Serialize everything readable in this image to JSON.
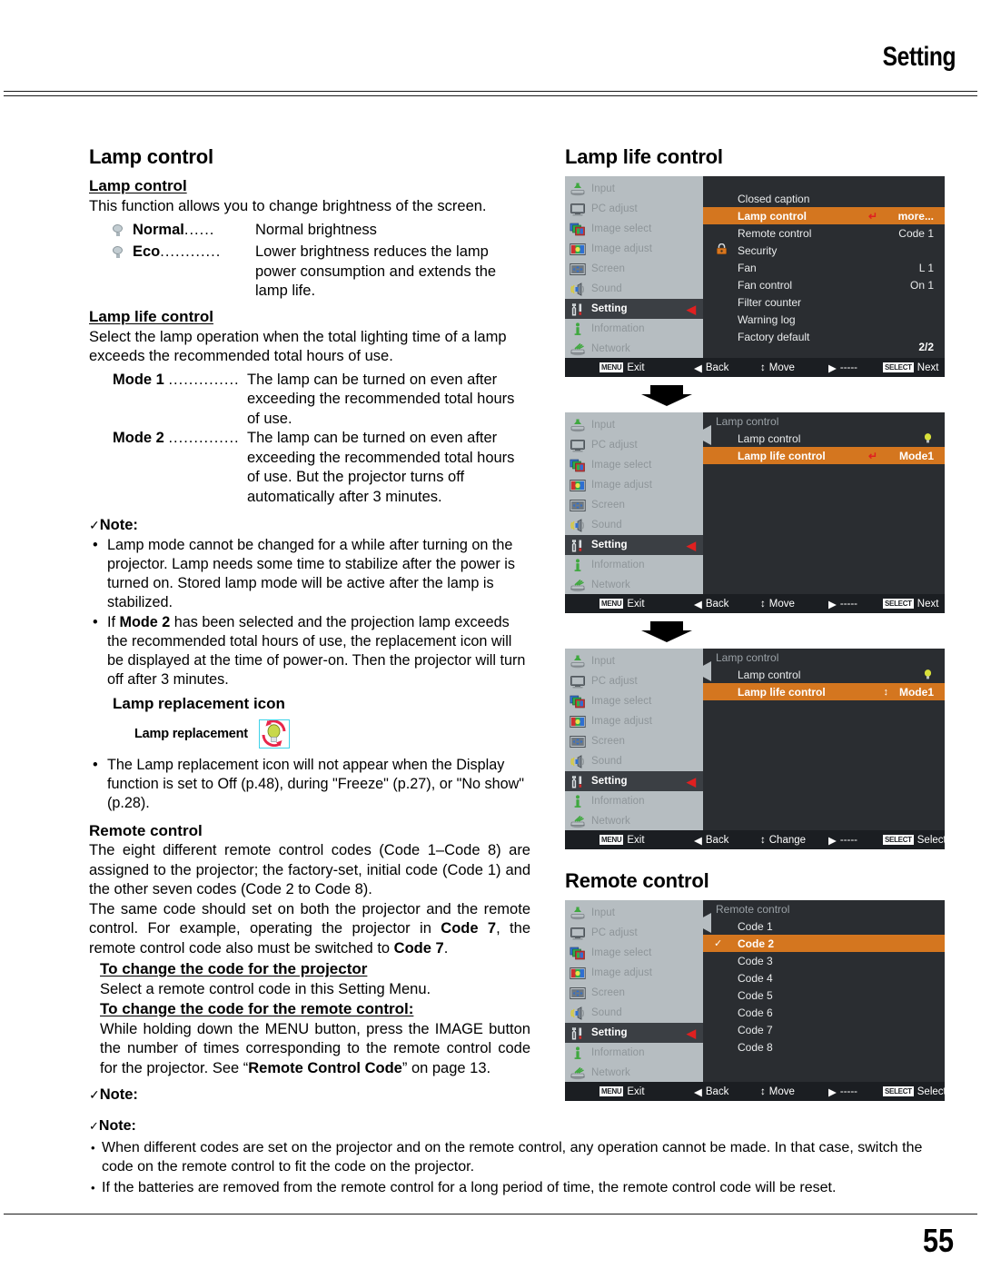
{
  "header": {
    "title": "Setting"
  },
  "page_number": "55",
  "left": {
    "section_title": "Lamp control",
    "lamp_control": {
      "heading": "Lamp control",
      "body": "This function allows you to change brightness of the screen.",
      "options": [
        {
          "term": "Normal",
          "dots": "......",
          "desc": "Normal brightness",
          "icon": "lamp-bulb-icon"
        },
        {
          "term": "Eco",
          "dots": "............",
          "desc": "Lower brightness reduces the lamp power consumption and extends the lamp life.",
          "icon": "lamp-bulb-icon"
        }
      ]
    },
    "lamp_life_control": {
      "heading": "Lamp life control",
      "body": "Select the lamp operation when the total lighting time of a lamp exceeds the recommended total hours of use.",
      "modes": [
        {
          "term": "Mode 1",
          "dots": "..............",
          "desc": "The lamp can be turned on even after exceeding the recommended total hours of use."
        },
        {
          "term": "Mode 2",
          "dots": "..............",
          "desc": "The lamp can be turned on even after exceeding the recommended total hours of use. But the projector turns off automatically after 3 minutes."
        }
      ]
    },
    "note_label": "Note:",
    "notes": [
      "Lamp mode cannot be changed for a while after turning on the projector. Lamp needs some time to stabilize after the power is turned on. Stored lamp mode will be active after the lamp is stabilized.",
      "If Mode 2 has been selected and the projection lamp exceeds the recommended total hours of use, the replacement icon will be displayed at the time of power-on. Then the projector will turn off after 3 minutes."
    ],
    "note2_bold": "Mode 2",
    "lamp_replacement": {
      "heading": "Lamp replacement icon",
      "banner_label": "Lamp replacement",
      "banner_color": "#f2f1c",
      "box_border_color": "#3fd2e8",
      "bulb_color": "#c8d84a",
      "arrow_color": "#e8264a"
    },
    "note_after_icon": "The Lamp replacement icon will not appear when the Display function is set to Off (p.48), during \"Freeze\" (p.27), or \"No show\" (p.28).",
    "remote_control": {
      "heading": "Remote control",
      "para1": "The eight different remote control codes (Code 1–Code 8) are assigned to the projector; the factory-set, initial code (Code 1) and the other seven codes (Code 2 to Code 8).",
      "para2_a": "The same code should set on both the projector and the remote control. For example, operating the projector in ",
      "para2_bold1": "Code 7",
      "para2_b": ", the remote control code also must be switched to ",
      "para2_bold2": "Code 7",
      "para2_c": ".",
      "sub1_heading": "To change the code for the projector",
      "sub1_body": "Select a remote control code in this Setting Menu.",
      "sub2_heading": "To change the code for the remote control:",
      "sub2_a": "While holding down the MENU button, press the IMAGE button the number of times corresponding to the remote control code for the projector. See “",
      "sub2_bold": "Remote Control Code",
      "sub2_b": "” on page 13."
    }
  },
  "right": {
    "heading_lamp_life": "Lamp life control",
    "heading_remote": "Remote control",
    "sidebar_items": [
      {
        "label": "Input",
        "icon": "input-icon"
      },
      {
        "label": "PC adjust",
        "icon": "monitor-icon"
      },
      {
        "label": "Image select",
        "icon": "image-select-icon"
      },
      {
        "label": "Image adjust",
        "icon": "image-adjust-icon"
      },
      {
        "label": "Screen",
        "icon": "screen-icon"
      },
      {
        "label": "Sound",
        "icon": "speaker-icon"
      },
      {
        "label": "Setting",
        "icon": "wrench-icon"
      },
      {
        "label": "Information",
        "icon": "info-icon"
      },
      {
        "label": "Network",
        "icon": "network-icon"
      }
    ],
    "active_sidebar": "Setting",
    "panels": [
      {
        "name": "setting-menu-panel",
        "title": "",
        "items": [
          {
            "label": "Closed caption",
            "value": ""
          },
          {
            "label": "Lamp control",
            "value": "more...",
            "highlight": true,
            "enter_arrow": true
          },
          {
            "label": "Remote control",
            "value": "Code 1"
          },
          {
            "label": "Security",
            "value": "",
            "icon": "lock-icon"
          },
          {
            "label": "Fan",
            "value": "L 1"
          },
          {
            "label": "Fan control",
            "value": "On 1"
          },
          {
            "label": "Filter counter",
            "value": ""
          },
          {
            "label": "Warning log",
            "value": ""
          },
          {
            "label": "Factory default",
            "value": ""
          }
        ],
        "page_indicator": "2/2",
        "footer": {
          "exit": "Exit",
          "back": "Back",
          "move": "Move",
          "dashes": "-----",
          "select": "Next",
          "menu_badge": "MENU",
          "select_badge": "SELECT"
        }
      },
      {
        "name": "lamp-control-submenu-panel",
        "title": "Lamp control",
        "items": [
          {
            "label": "Lamp control",
            "value": "",
            "lamp_dot": true
          },
          {
            "label": "Lamp life control",
            "value": "Mode1",
            "highlight": true,
            "enter_arrow": true
          }
        ],
        "page_indicator": "",
        "footer": {
          "exit": "Exit",
          "back": "Back",
          "move": "Move",
          "dashes": "-----",
          "select": "Next",
          "menu_badge": "MENU",
          "select_badge": "SELECT"
        }
      },
      {
        "name": "lamp-life-control-change-panel",
        "title": "Lamp control",
        "items": [
          {
            "label": "Lamp control",
            "value": "",
            "lamp_dot": true
          },
          {
            "label": "Lamp life control",
            "value": "Mode1",
            "highlight": true,
            "updown_arrow": true
          }
        ],
        "page_indicator": "",
        "footer": {
          "exit": "Exit",
          "back": "Back",
          "move": "Change",
          "dashes": "-----",
          "select": "Select",
          "menu_badge": "MENU",
          "select_badge": "SELECT"
        }
      },
      {
        "name": "remote-control-code-panel",
        "title": "Remote control",
        "items": [
          {
            "label": "Code 1",
            "value": ""
          },
          {
            "label": "Code 2",
            "value": "",
            "highlight": true,
            "check": true
          },
          {
            "label": "Code 3",
            "value": ""
          },
          {
            "label": "Code 4",
            "value": ""
          },
          {
            "label": "Code 5",
            "value": ""
          },
          {
            "label": "Code 6",
            "value": ""
          },
          {
            "label": "Code 7",
            "value": ""
          },
          {
            "label": "Code 8",
            "value": ""
          }
        ],
        "page_indicator": "",
        "footer": {
          "exit": "Exit",
          "back": "Back",
          "move": "Move",
          "dashes": "-----",
          "select": "Select",
          "menu_badge": "MENU",
          "select_badge": "SELECT"
        }
      }
    ]
  },
  "bottom": {
    "note_label": "Note:",
    "notes": [
      "When different codes are set on the projector and on the remote control, any operation cannot be made. In that case, switch the code on the remote control to fit the code on the projector.",
      "If the batteries are removed from the remote control for a long period of time, the remote control code will be reset."
    ]
  },
  "colors": {
    "osd_highlight": "#d4761f",
    "osd_sidebar": "#b6bdc1",
    "osd_main": "#2a2d31",
    "osd_footer": "#1b1e22",
    "accent_red": "#e02020"
  }
}
